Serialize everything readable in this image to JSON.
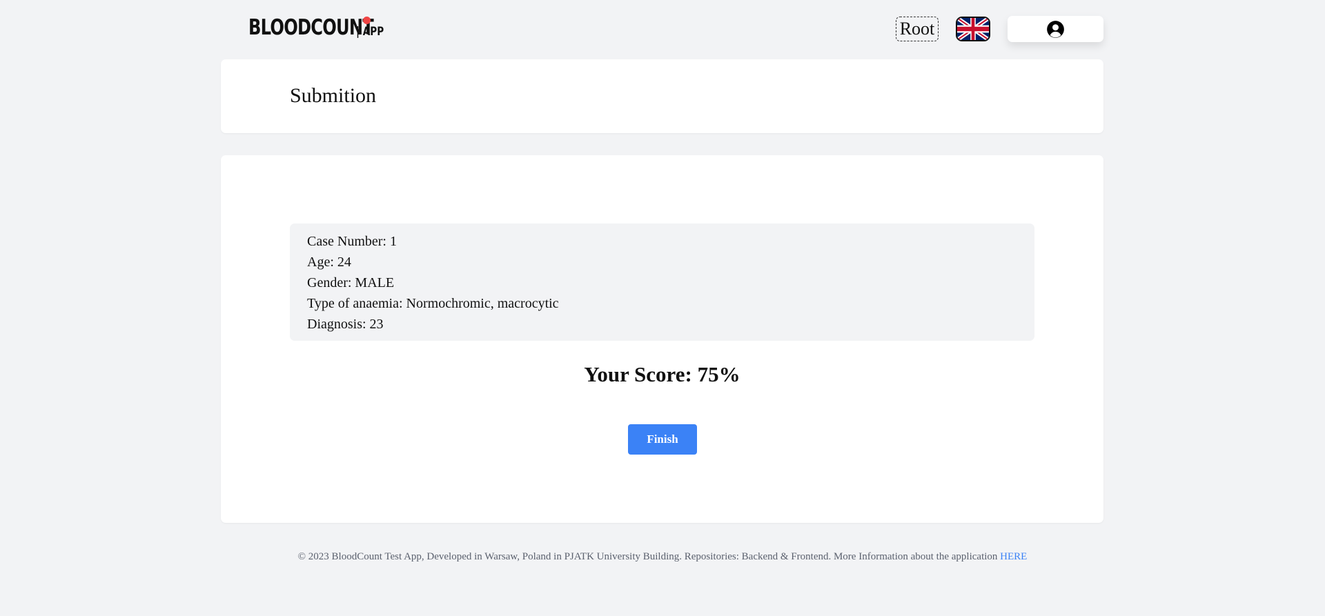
{
  "header": {
    "logo_text": "BLOODCOUNT",
    "logo_suffix": "| APP",
    "user_label": "Root",
    "language_icon": "uk-flag-icon",
    "profile_icon": "user-circle-icon"
  },
  "title": "Submition",
  "case": {
    "case_number": "Case Number: 1",
    "age": "Age: 24",
    "gender": "Gender: MALE",
    "anaemia_type": "Type of anaemia: Normochromic, macrocytic",
    "diagnosis": "Diagnosis: 23"
  },
  "score": "Your Score: 75%",
  "finish_label": "Finish",
  "footer": {
    "text": "© 2023 BloodCount Test App, Developed in Warsaw, Poland in PJATK University Building. Repositories: Backend & Frontend. More Information about the application ",
    "link": "HERE"
  },
  "colors": {
    "accent": "#3b82f6",
    "logo_dot": "#ef4444",
    "background": "#f2f3f5"
  }
}
